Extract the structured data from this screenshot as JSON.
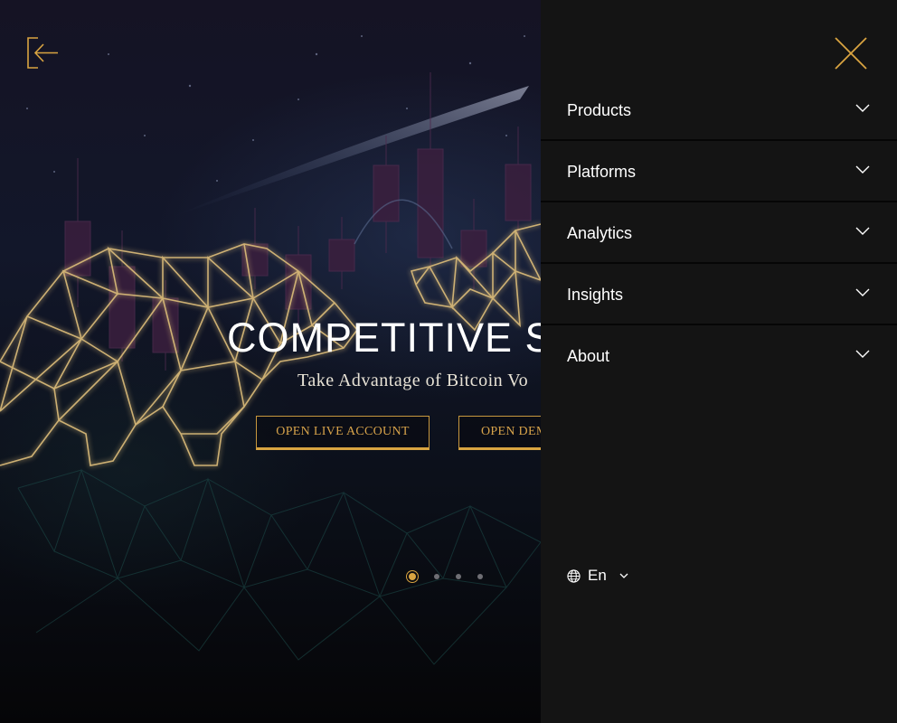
{
  "hero": {
    "title": "COMPETITIVE SP",
    "subtitle": "Take Advantage of Bitcoin Vo",
    "cta_live": "OPEN LIVE ACCOUNT",
    "cta_demo": "OPEN DEM",
    "slides": 4,
    "active_slide": 1
  },
  "menu": {
    "items": [
      {
        "label": "Products"
      },
      {
        "label": "Platforms"
      },
      {
        "label": "Analytics"
      },
      {
        "label": "Insights"
      },
      {
        "label": "About"
      }
    ],
    "language": "En"
  },
  "icons": {
    "back": "arrow-left-bracket-icon",
    "close": "close-icon",
    "chevron": "chevron-down-icon",
    "globe": "globe-icon"
  },
  "colors": {
    "accent": "#d9a441",
    "menu_bg": "#141414",
    "menu_divider": "#060606",
    "hero_bg": "#12172a"
  }
}
